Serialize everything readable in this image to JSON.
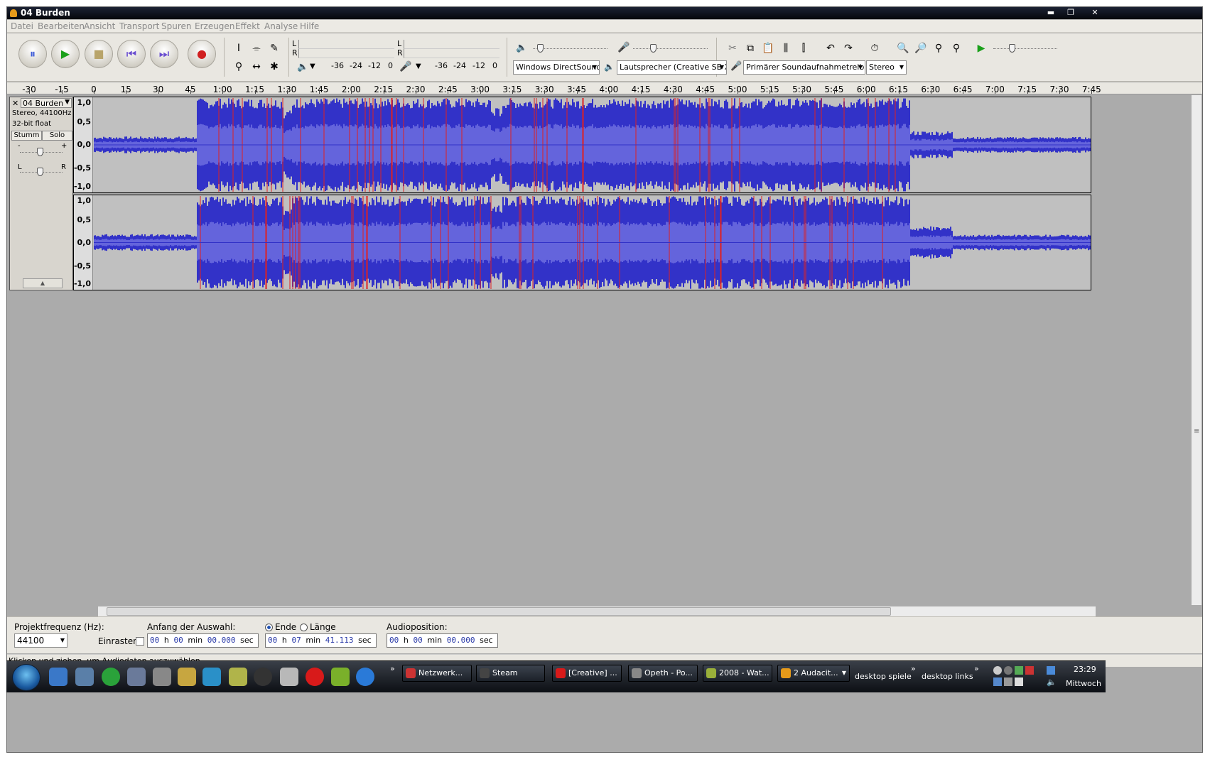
{
  "window": {
    "title": "04 Burden",
    "minimize": "▬",
    "maximize": "❐",
    "close": "✕"
  },
  "menu": [
    "Datei",
    "Bearbeiten",
    "Ansicht",
    "Transport",
    "Spuren",
    "Erzeugen",
    "Effekt",
    "Analyse",
    "Hilfe"
  ],
  "transport": {
    "pause": "⏸",
    "play": "▶",
    "stop": "■",
    "skip_start": "⏮",
    "skip_end": "⏭",
    "record": "●"
  },
  "tools": {
    "select": "I",
    "envelope": "⌯",
    "draw": "✎",
    "zoom": "⚲",
    "timeshift": "↔",
    "multi": "✱"
  },
  "meters": {
    "L": "L",
    "R": "R",
    "ticks": [
      "-36",
      "-24",
      "-12",
      "0"
    ],
    "ticks2": [
      "-36",
      "-24",
      "-12",
      "0"
    ]
  },
  "devices": {
    "host": "Windows DirectSound",
    "output": "Lautsprecher (Creative SB X-F",
    "input": "Primärer Soundaufnahmetreiber",
    "channels": "Stereo"
  },
  "ruler": {
    "labels": [
      "-30",
      "-15",
      "0",
      "15",
      "30",
      "45",
      "1:00",
      "1:15",
      "1:30",
      "1:45",
      "2:00",
      "2:15",
      "2:30",
      "2:45",
      "3:00",
      "3:15",
      "3:30",
      "3:45",
      "4:00",
      "4:15",
      "4:30",
      "4:45",
      "5:00",
      "5:15",
      "5:30",
      "5:45",
      "6:00",
      "6:15",
      "6:30",
      "6:45",
      "7:00",
      "7:15",
      "7:30",
      "7:45"
    ]
  },
  "track": {
    "name": "04 Burden",
    "format": "Stereo, 44100Hz",
    "depth": "32-bit float",
    "mute": "Stumm",
    "solo": "Solo",
    "gain_minus": "-",
    "gain_plus": "+",
    "pan_left": "L",
    "pan_right": "R",
    "collapse": "▲",
    "close": "✕",
    "menu": "▼",
    "scale": [
      "1,0",
      "0,5",
      "0,0",
      "-0,5",
      "-1,0"
    ],
    "wave_color": "#3232c8",
    "wave_rms_color": "#6464dc",
    "clip_color": "#e02020"
  },
  "selection": {
    "rate_label": "Projektfrequenz (Hz):",
    "rate": "44100",
    "snap_label": "Einrasten",
    "start_label": "Anfang der Auswahl:",
    "end_radio": "Ende",
    "length_radio": "Länge",
    "pos_label": "Audioposition:",
    "start": {
      "h": "00",
      "m": "00",
      "s": "00.000",
      "u_h": "h",
      "u_m": "min",
      "u_s": "sec"
    },
    "end": {
      "h": "00",
      "m": "07",
      "s": "41.113",
      "u_h": "h",
      "u_m": "min",
      "u_s": "sec"
    },
    "pos": {
      "h": "00",
      "m": "00",
      "s": "00.000",
      "u_h": "h",
      "u_m": "min",
      "u_s": "sec"
    }
  },
  "status": "Klicken und ziehen, um Audiodaten auszuwählen",
  "taskbar": {
    "tasks": [
      "Netzwerk...",
      "Steam",
      "[Creative] ...",
      "Opeth - Po...",
      "2008 - Wat...",
      "2 Audacit..."
    ],
    "toolbar1": "desktop spiele",
    "toolbar2": "desktop links",
    "chev": "»",
    "time": "23:29",
    "day": "Mittwoch"
  }
}
